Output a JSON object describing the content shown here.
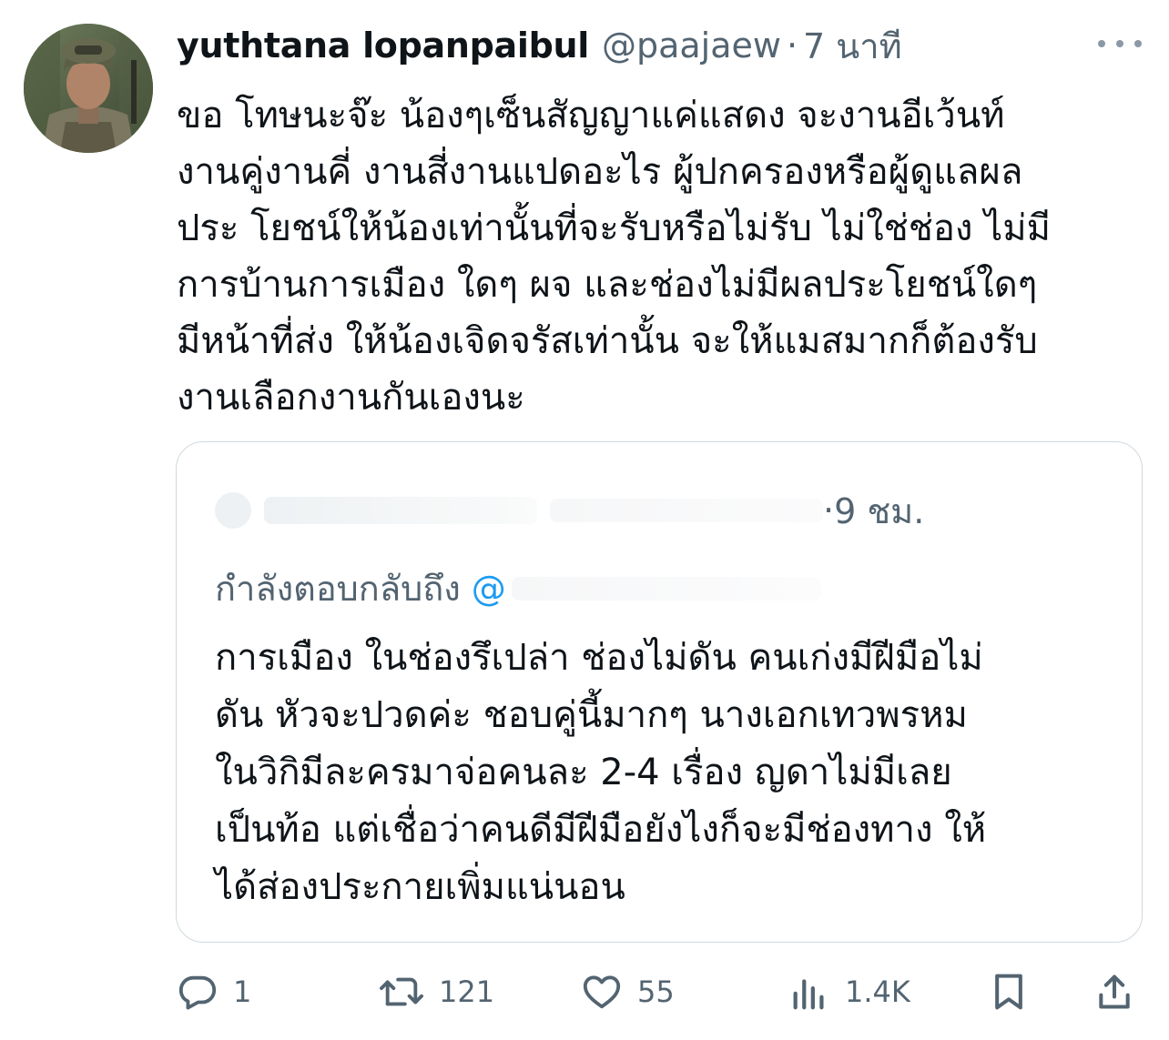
{
  "author": {
    "display_name": "yuthtana lopanpaibul",
    "handle": "@paajaew",
    "separator": "·",
    "timestamp": "7 นาที"
  },
  "tweet": {
    "lines": [
      "ขอ โทษนะจ๊ะ น้องๆเซ็นสัญญาแค่แสดง จะงานอีเว้นท์",
      "งานคู่งานคี่ งานสี่งานแปดอะไร ผู้ปกครองหรือผู้ดูแลผล",
      "ประ โยชน์ให้น้องเท่านั้นที่จะรับหรือไม่รับ ไม่ใช่ช่อง ไม่มี",
      "การบ้านการเมือง ใดๆ ผจ และช่องไม่มีผลประโยชน์ใดๆ",
      "มีหน้าที่ส่ง ให้น้องเจิดจรัสเท่านั้น จะให้แมสมากก็ต้องรับ",
      "งานเลือกงานกันเองนะ"
    ]
  },
  "quote": {
    "separator": "·",
    "timestamp": "9 ชม.",
    "replying_to_label": "กำลังตอบกลับถึง",
    "mention_prefix": "@",
    "lines": [
      "การเมือง ในช่องรึเปล่า ช่องไม่ดัน คนเก่งมีฝีมือไม่",
      "ดัน หัวจะปวดค่ะ ชอบคู่นี้มากๆ นางเอกเทวพรหม",
      "ในวิกิมีละครมาจ่อคนละ 2-4 เรื่อง ญดาไม่มีเลย",
      "เป็นท้อ แต่เชื่อว่าคนดีมีฝีมือยังไงก็จะมีช่องทาง ให้",
      "ได้ส่องประกายเพิ่มแน่นอน"
    ]
  },
  "actions": {
    "reply_count": "1",
    "retweet_count": "121",
    "like_count": "55",
    "views_count": "1.4K"
  },
  "icons": {
    "more": "more-horizontal-icon",
    "reply": "reply-icon",
    "retweet": "retweet-icon",
    "like": "heart-icon",
    "views": "views-icon",
    "bookmark": "bookmark-icon",
    "share": "share-icon"
  },
  "colors": {
    "text": "#0f1419",
    "secondary": "#536471",
    "mention": "#1d9bf0",
    "border": "#cfd9de"
  }
}
